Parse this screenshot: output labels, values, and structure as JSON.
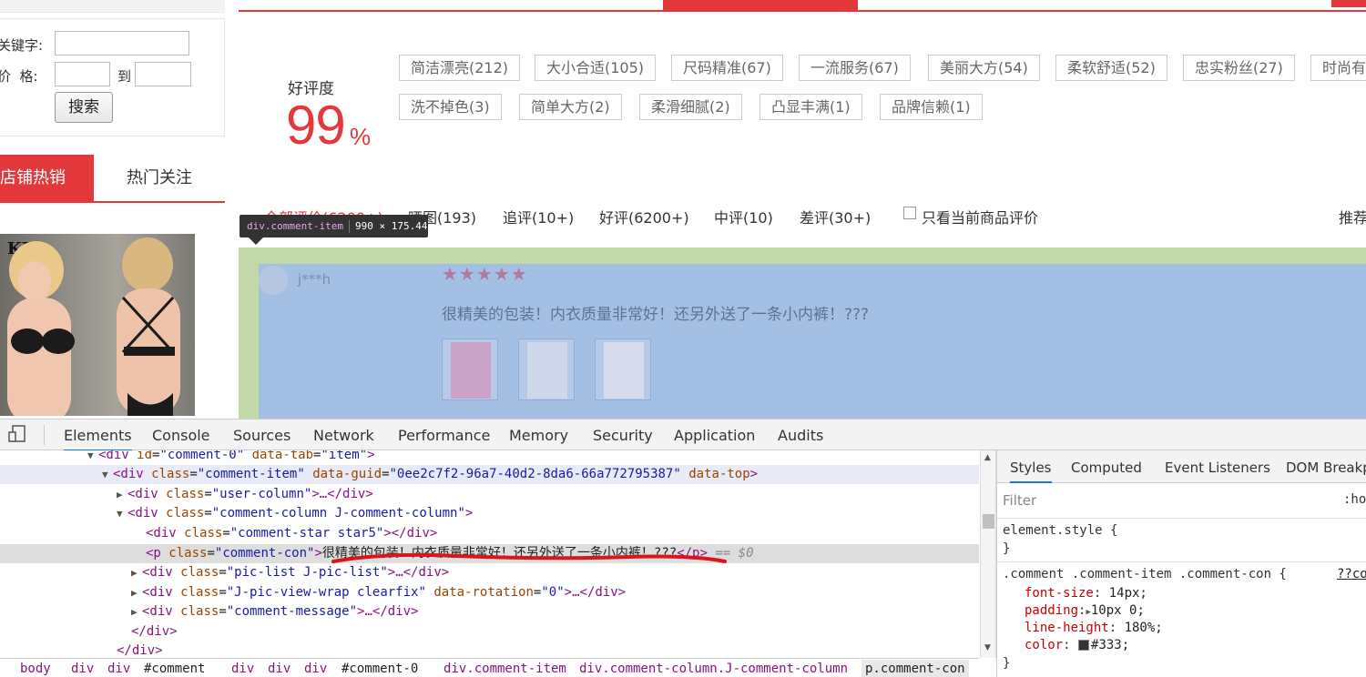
{
  "search": {
    "keyword_label": "关键字:",
    "price_label": "价  格:",
    "to_label": "到",
    "button": "搜索"
  },
  "shop_tabs": {
    "hot_sale": "店铺热销",
    "hot_follow": "热门关注"
  },
  "rating": {
    "label": "好评度",
    "value": "99",
    "percent": "%",
    "tags": [
      "简洁漂亮(212)",
      "大小合适(105)",
      "尺码精准(67)",
      "一流服务(67)",
      "美丽大方(54)",
      "柔软舒适(52)",
      "忠实粉丝(27)",
      "时尚有",
      "洗不掉色(3)",
      "简单大方(2)",
      "柔滑细腻(2)",
      "凸显丰满(1)",
      "品牌信赖(1)"
    ]
  },
  "filter": {
    "all": "全部评价(6200+)",
    "pics": "晒图(193)",
    "follow_up": "追评(10+)",
    "good": "好评(6200+)",
    "medium": "中评(10)",
    "bad": "差评(30+)",
    "only_current": "只看当前商品评价",
    "sort": "推荐"
  },
  "tooltip": {
    "selector": "div.comment-item",
    "size": "990 × 175.44"
  },
  "comment": {
    "user": "j***h",
    "stars": "★★★★★",
    "text": "很精美的包装！内衣质量非常好！还另外送了一条小内裤！???"
  },
  "devtools": {
    "tabs": [
      "Elements",
      "Console",
      "Sources",
      "Network",
      "Performance",
      "Memory",
      "Security",
      "Application",
      "Audits"
    ],
    "dom": {
      "l1": {
        "tag_open": "<div ",
        "a1": "id",
        "v1": "\"comment-0\"",
        "a2": "data-tab",
        "v2": "\"item\"",
        "close": ">"
      },
      "l2": {
        "tag_open": "<div ",
        "a1": "class",
        "v1": "\"comment-item\"",
        "a2": "data-guid",
        "v2": "\"0ee2c7f2-96a7-40d2-8da6-66a772795387\"",
        "a3": "data-top",
        "close": ">"
      },
      "l3": {
        "tag_open": "<div ",
        "a1": "class",
        "v1": "\"user-column\"",
        "rest": ">…</div>"
      },
      "l4": {
        "tag_open": "<div ",
        "a1": "class",
        "v1": "\"comment-column J-comment-column\"",
        "close": ">"
      },
      "l5": {
        "tag_open": "<div ",
        "a1": "class",
        "v1": "\"comment-star star5\"",
        "rest": "></div>"
      },
      "l6": {
        "tag_open": "<p ",
        "a1": "class",
        "v1": "\"comment-con\"",
        "close": ">",
        "text": "很精美的包装！内衣质量非常好！还另外送了一条小内裤！???",
        "end": "</p>",
        "marker": " == $0"
      },
      "l7": {
        "tag_open": "<div ",
        "a1": "class",
        "v1": "\"pic-list J-pic-list\"",
        "rest": ">…</div>"
      },
      "l8": {
        "tag_open": "<div ",
        "a1": "class",
        "v1": "\"J-pic-view-wrap clearfix\"",
        "a2": "data-rotation",
        "v2": "\"0\"",
        "rest": ">…</div>"
      },
      "l9": {
        "tag_open": "<div ",
        "a1": "class",
        "v1": "\"comment-message\"",
        "rest": ">…</div>"
      },
      "l10": "</div>",
      "l11": "</div>"
    },
    "breadcrumb": [
      "body",
      "div",
      "div",
      "#comment",
      "div",
      "div",
      "div",
      "#comment-0",
      "div.comment-item",
      "div.comment-column.J-comment-column",
      "p.comment-con"
    ],
    "styles_tabs": [
      "Styles",
      "Computed",
      "Event Listeners",
      "DOM Breakp"
    ],
    "filter_placeholder": "Filter",
    "hov": ":ho",
    "element_style": "element.style {",
    "close_brace": "}",
    "rule_selector": ".comment .comment-item .comment-con {",
    "rule_source": "??co",
    "props": [
      {
        "name": "font-size",
        "value": "14px;"
      },
      {
        "name": "padding",
        "value": "10px 0;"
      },
      {
        "name": "line-height",
        "value": "180%;"
      },
      {
        "name": "color",
        "value": "#333;"
      }
    ]
  },
  "colors": {
    "accent_red": "#e4393c",
    "highlight_margin": "#c3d9a9",
    "highlight_content": "#a3c0e4"
  }
}
